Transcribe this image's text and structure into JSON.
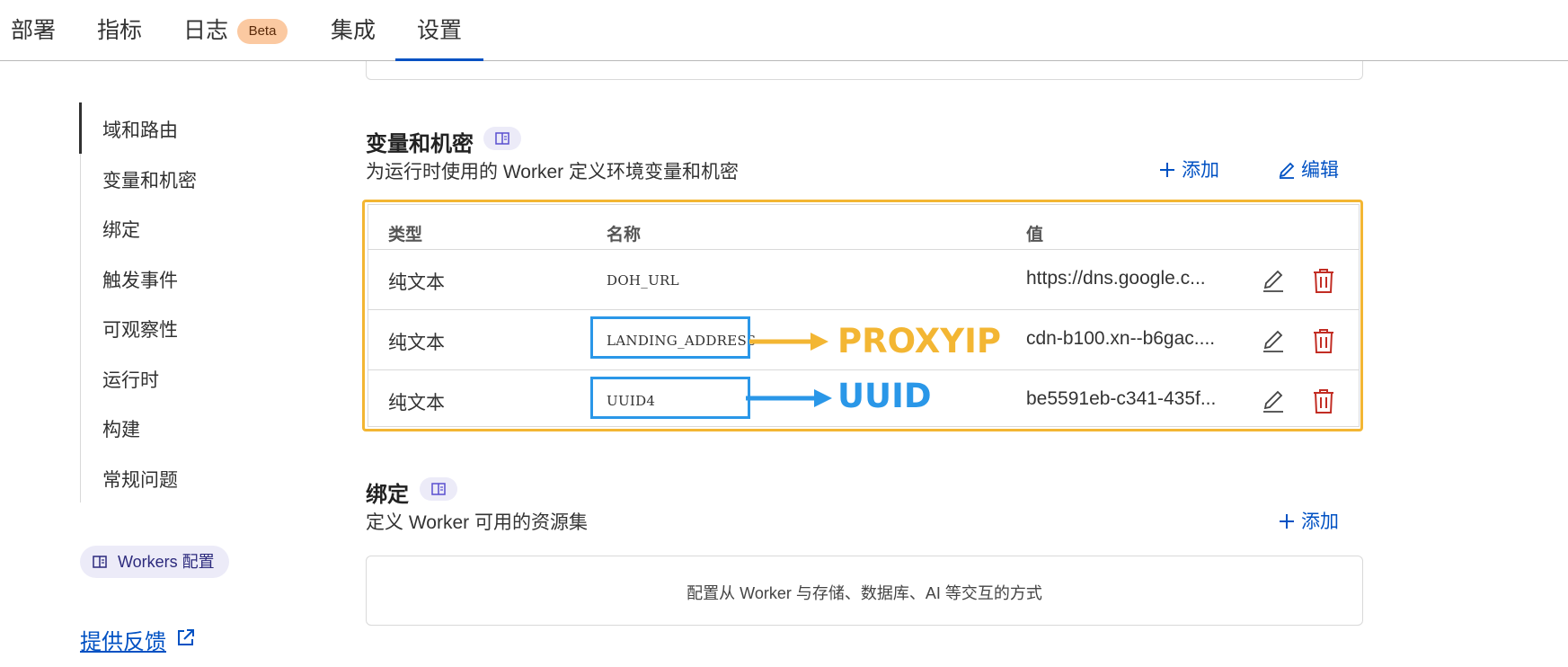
{
  "tabs": [
    {
      "label": "部署"
    },
    {
      "label": "指标"
    },
    {
      "label": "日志",
      "badge": "Beta"
    },
    {
      "label": "集成"
    },
    {
      "label": "设置",
      "active": true
    }
  ],
  "sidebar": {
    "items": [
      {
        "label": "域和路由",
        "active": true
      },
      {
        "label": "变量和机密"
      },
      {
        "label": "绑定"
      },
      {
        "label": "触发事件"
      },
      {
        "label": "可观察性"
      },
      {
        "label": "运行时"
      },
      {
        "label": "构建"
      },
      {
        "label": "常规问题"
      }
    ],
    "docs_label": "Workers 配置",
    "feedback_label": "提供反馈"
  },
  "variables": {
    "title": "变量和机密",
    "subtitle": "为运行时使用的 Worker 定义环境变量和机密",
    "add_label": "添加",
    "edit_label": "编辑",
    "columns": [
      "类型",
      "名称",
      "值"
    ],
    "rows": [
      {
        "type": "纯文本",
        "name": "DOH_URL",
        "value": "https://dns.google.c..."
      },
      {
        "type": "纯文本",
        "name": "LANDING_ADDRESS",
        "value": "cdn-b100.xn--b6gac...."
      },
      {
        "type": "纯文本",
        "name": "UUID4",
        "value": "be5591eb-c341-435f..."
      }
    ]
  },
  "annotations": {
    "proxyip_label": "PROXYIP",
    "uuid_label": "UUID",
    "highlight_color": "#f3b633",
    "box_color": "#2a97e8"
  },
  "bindings": {
    "title": "绑定",
    "subtitle": "定义 Worker 可用的资源集",
    "add_label": "添加",
    "empty_text": "配置从 Worker 与存储、数据库、AI 等交互的方式"
  },
  "colors": {
    "accent": "#0051c3",
    "danger": "#c22d24",
    "beta_badge": "#fbc9a1"
  }
}
